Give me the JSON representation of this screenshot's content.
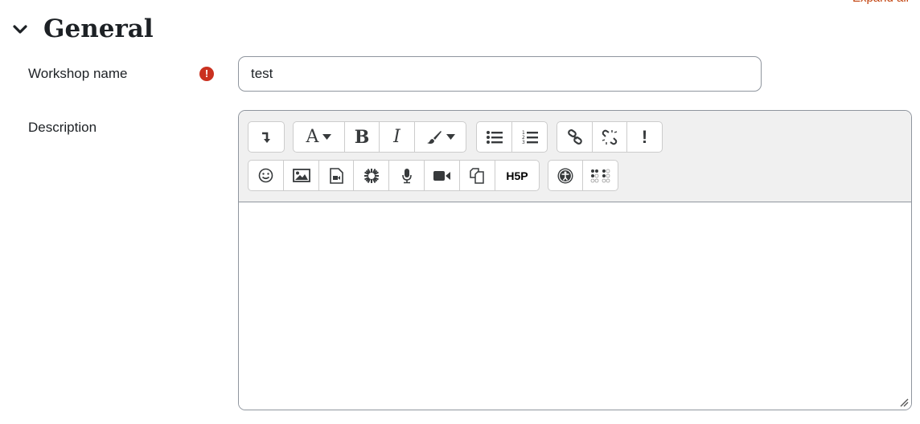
{
  "header": {
    "expand_all": "Expand all"
  },
  "section": {
    "title": "General",
    "chevron_icon": "chevron-down-icon"
  },
  "fields": {
    "workshop_name": {
      "label": "Workshop name",
      "value": "test",
      "required_icon": "exclamation-circle-icon",
      "required_color": "#ca3120"
    },
    "description": {
      "label": "Description",
      "value": ""
    }
  },
  "toolbar": {
    "row1": [
      {
        "group": "collapse",
        "buttons": [
          {
            "name": "show-more-buttons",
            "icon": "collapse-arrow-icon"
          }
        ]
      },
      {
        "group": "style",
        "buttons": [
          {
            "name": "paragraph-styles",
            "glyph": "A",
            "icon": "font-style-icon"
          },
          {
            "name": "bold",
            "glyph": "B",
            "icon": "bold-icon"
          },
          {
            "name": "italic",
            "glyph": "I",
            "icon": "italic-icon"
          },
          {
            "name": "font-color",
            "icon": "paintbrush-icon"
          }
        ]
      },
      {
        "group": "list",
        "buttons": [
          {
            "name": "unordered-list",
            "icon": "unordered-list-icon"
          },
          {
            "name": "ordered-list",
            "icon": "ordered-list-icon"
          }
        ]
      },
      {
        "group": "links",
        "buttons": [
          {
            "name": "link",
            "icon": "link-icon"
          },
          {
            "name": "unlink",
            "icon": "unlink-icon"
          },
          {
            "name": "manage-files",
            "glyph": "!",
            "icon": "exclamation-icon"
          }
        ]
      }
    ],
    "row2": [
      {
        "group": "files",
        "buttons": [
          {
            "name": "emoji",
            "icon": "smiley-icon"
          },
          {
            "name": "image",
            "icon": "image-icon"
          },
          {
            "name": "media",
            "icon": "video-file-icon"
          },
          {
            "name": "recordrtc",
            "icon": "asterisk-icon"
          },
          {
            "name": "record-audio",
            "icon": "microphone-icon"
          },
          {
            "name": "record-video",
            "icon": "video-camera-icon"
          },
          {
            "name": "manage-files",
            "icon": "files-icon"
          },
          {
            "name": "h5p",
            "glyph": "H5P",
            "icon": "h5p-icon"
          }
        ]
      },
      {
        "group": "accessibility",
        "buttons": [
          {
            "name": "accessibility-checker",
            "icon": "accessibility-icon"
          },
          {
            "name": "screenreader-helper",
            "icon": "braille-icon"
          }
        ]
      }
    ]
  }
}
